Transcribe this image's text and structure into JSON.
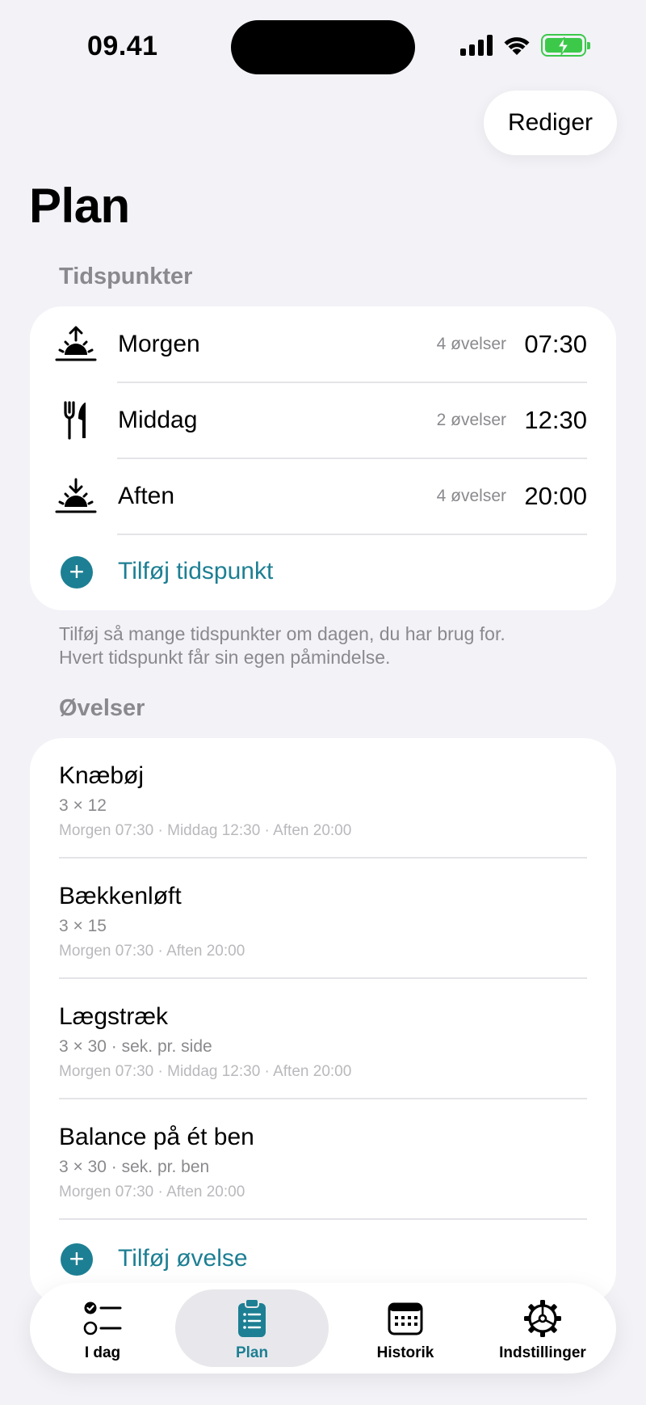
{
  "status_bar": {
    "time": "09.41"
  },
  "header": {
    "edit_label": "Rediger",
    "title": "Plan"
  },
  "times_section": {
    "header": "Tidspunkter",
    "items": [
      {
        "label": "Morgen",
        "count": "4 øvelser",
        "time": "07:30",
        "icon": "sunrise-icon"
      },
      {
        "label": "Middag",
        "count": "2 øvelser",
        "time": "12:30",
        "icon": "fork-knife-icon"
      },
      {
        "label": "Aften",
        "count": "4 øvelser",
        "time": "20:00",
        "icon": "sunset-icon"
      }
    ],
    "add_label": "Tilføj tidspunkt",
    "footer_line1": "Tilføj så mange tidspunkter om dagen, du har brug for.",
    "footer_line2": "Hvert tidspunkt får sin egen påmindelse."
  },
  "exercises_section": {
    "header": "Øvelser",
    "items": [
      {
        "name": "Knæbøj",
        "sets": "3 × 12",
        "times": "Morgen 07:30 · Middag 12:30 · Aften 20:00"
      },
      {
        "name": "Bækkenløft",
        "sets": "3 × 15",
        "times": "Morgen 07:30 · Aften 20:00"
      },
      {
        "name": "Lægstræk",
        "sets": "3 × 30 · sek. pr. side",
        "times": "Morgen 07:30 · Middag 12:30 · Aften 20:00"
      },
      {
        "name": "Balance på ét ben",
        "sets": "3 × 30 · sek. pr. ben",
        "times": "Morgen 07:30 · Aften 20:00"
      }
    ],
    "add_label": "Tilføj øvelse"
  },
  "tabbar": {
    "tabs": [
      {
        "label": "I dag",
        "icon": "checklist-icon"
      },
      {
        "label": "Plan",
        "icon": "clipboard-icon",
        "active": true
      },
      {
        "label": "Historik",
        "icon": "calendar-icon"
      },
      {
        "label": "Indstillinger",
        "icon": "gear-icon"
      }
    ]
  },
  "colors": {
    "accent": "#1d7f93",
    "background": "#f2f2f7",
    "secondary_text": "#8a8a8e",
    "battery": "#3cc94a"
  }
}
